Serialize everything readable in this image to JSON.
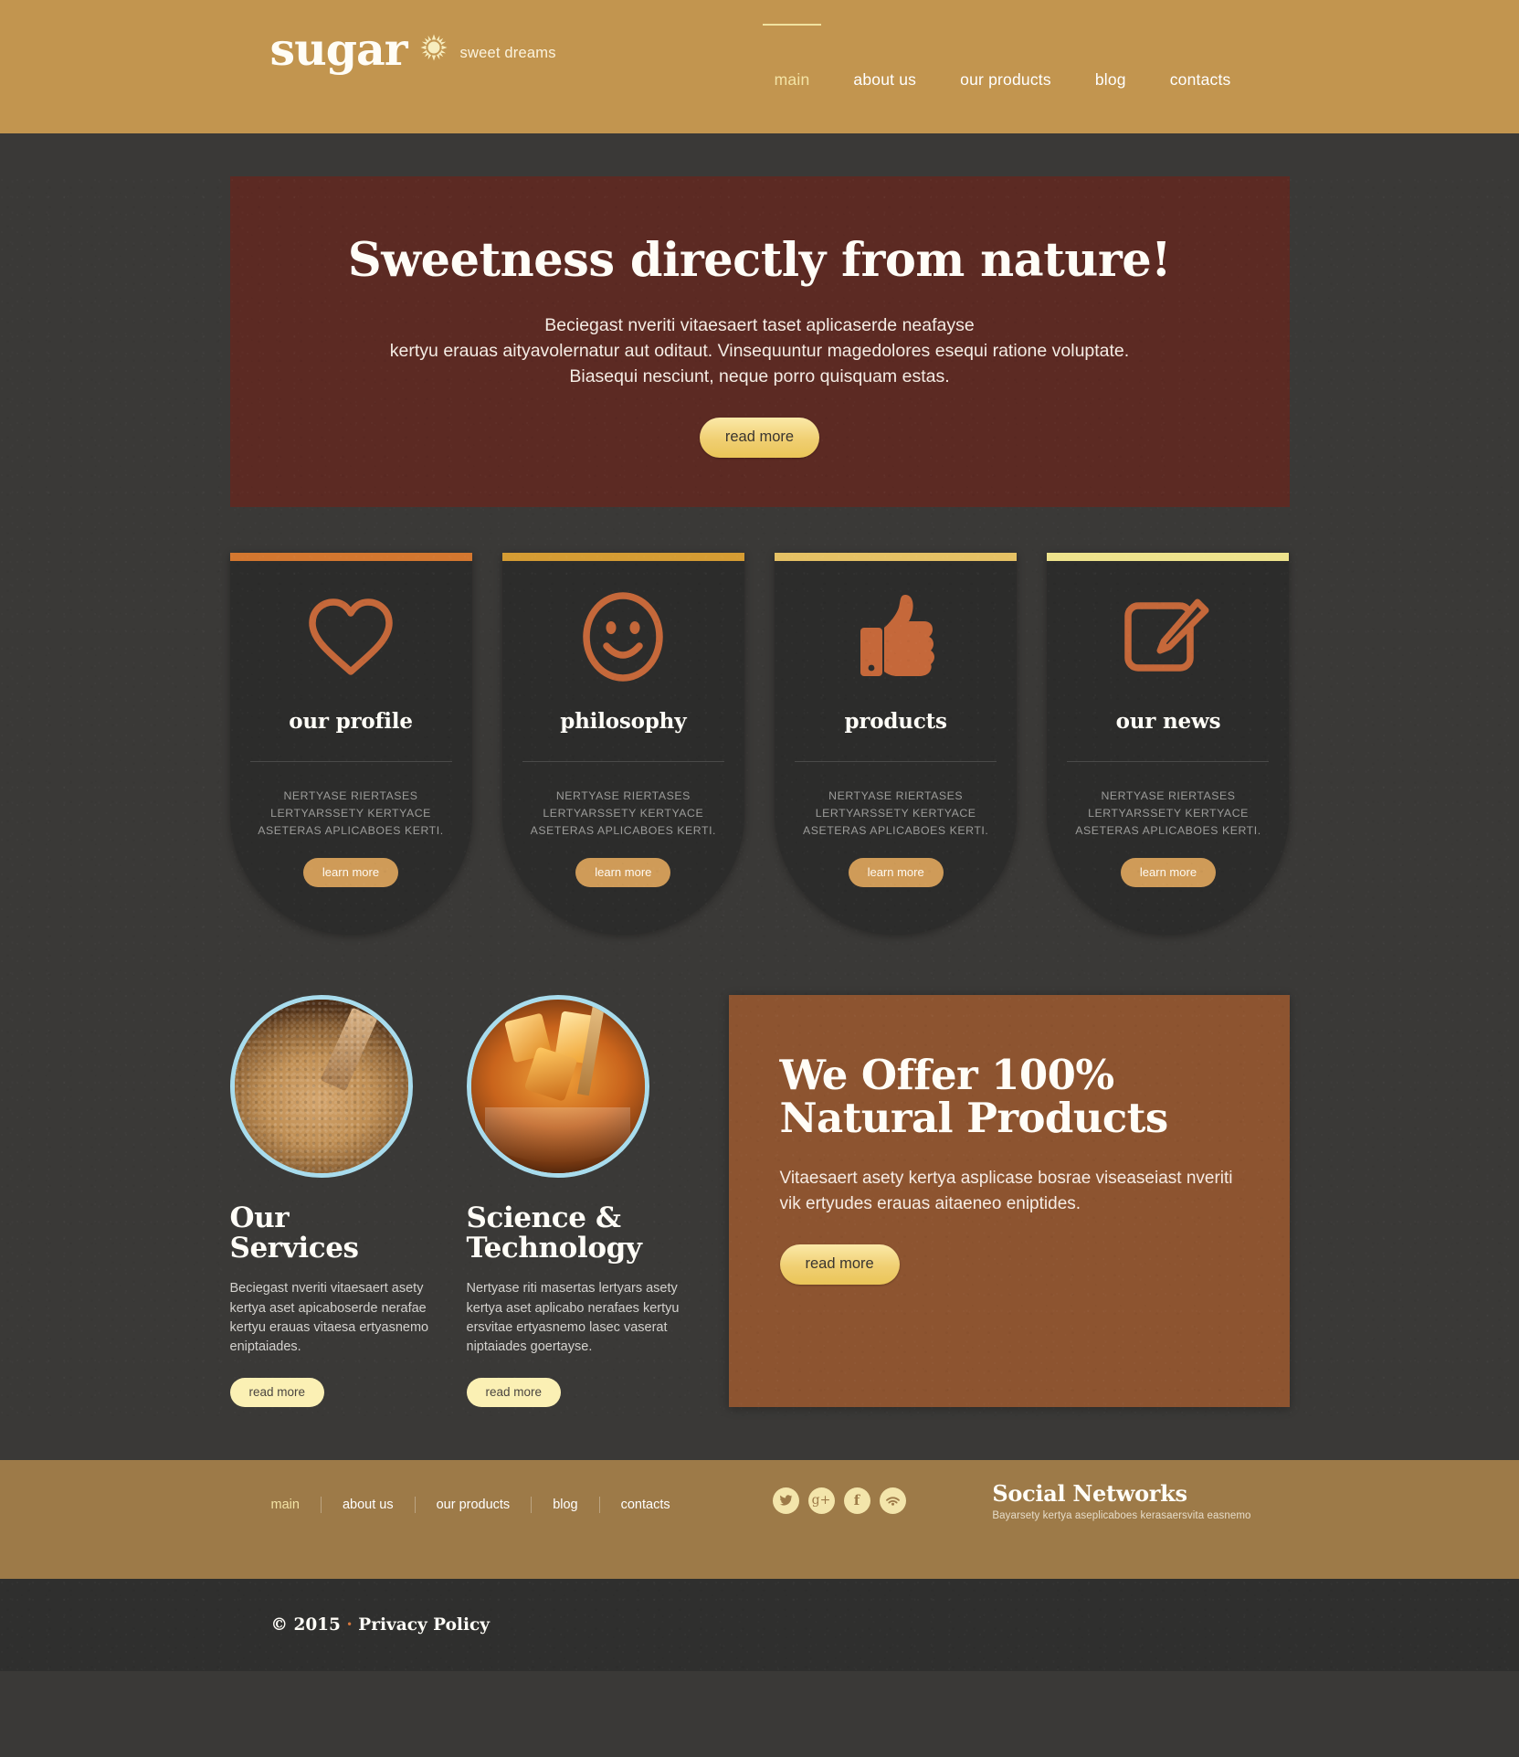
{
  "header": {
    "logo": "sugar",
    "logo_icon": "sun-icon",
    "tagline": "sweet dreams",
    "nav": [
      {
        "label": "main",
        "active": true
      },
      {
        "label": "about us",
        "active": false
      },
      {
        "label": "our products",
        "active": false
      },
      {
        "label": "blog",
        "active": false
      },
      {
        "label": "contacts",
        "active": false
      }
    ],
    "bg_color": "#c2954f",
    "accent_color": "#f0e2a0"
  },
  "hero": {
    "title": "Sweetness directly from nature!",
    "line1": "Beciegast nveriti vitaesaert taset aplicaserde neafayse",
    "line2": "kertyu erauas aityavolernatur aut oditaut. Vinsequuntur magedolores esequi ratione voluptate.",
    "line3": "Biasequi nesciunt, neque porro quisquam estas.",
    "button": "read more",
    "bg_color": "#5c2a23"
  },
  "cards": [
    {
      "icon": "heart-icon",
      "title": "our profile",
      "text": "NERTYASE RIERTASES LERTYARSSETY KERTYACE ASETERAS APLICABOES KERTI.",
      "button": "learn more",
      "bar_color": "#d4772f"
    },
    {
      "icon": "smiley-icon",
      "title": "philosophy",
      "text": "NERTYASE RIERTASES LERTYARSSETY KERTYACE ASETERAS APLICABOES KERTI.",
      "button": "learn more",
      "bar_color": "#d59c33"
    },
    {
      "icon": "thumbs-up-icon",
      "title": "products",
      "text": "NERTYASE RIERTASES LERTYARSSETY KERTYACE ASETERAS APLICABOES KERTI.",
      "button": "learn more",
      "bar_color": "#e5c164"
    },
    {
      "icon": "edit-icon",
      "title": "our news",
      "text": "NERTYASE RIERTASES LERTYARSSETY KERTYACE ASETERAS APLICABOES KERTI.",
      "button": "learn more",
      "bar_color": "#eee38c"
    }
  ],
  "services": [
    {
      "image": "brown-sugar-bowl-photo",
      "title": "Our\nServices",
      "text": "Beciegast nveriti vitaesaert asety kertya aset apicaboserde nerafae kertyu erauas vitaesa ertyasnemo eniptaiades.",
      "button": "read more"
    },
    {
      "image": "rock-candy-honey-photo",
      "title": "Science &\nTechnology",
      "text": "Nertyase riti masertas lertyars asety kertya aset aplicabo nerafaes kertyu ersvitae ertyasnemo lasec vaserat niptaiades goertayse.",
      "button": "read more"
    }
  ],
  "offer": {
    "title": "We Offer 100% Natural Products",
    "text": "Vitaesaert asety kertya asplicase bosrae viseaseiast nveriti vik ertyudes erauas aitaeneo eniptides.",
    "button": "read more",
    "bg_color": "#8d5430"
  },
  "footer": {
    "nav": [
      {
        "label": "main",
        "active": true
      },
      {
        "label": "about us",
        "active": false
      },
      {
        "label": "our products",
        "active": false
      },
      {
        "label": "blog",
        "active": false
      },
      {
        "label": "contacts",
        "active": false
      }
    ],
    "socials": [
      {
        "name": "twitter-icon",
        "glyph": ""
      },
      {
        "name": "google-plus-icon",
        "glyph": "g+"
      },
      {
        "name": "facebook-icon",
        "glyph": "f"
      },
      {
        "name": "rss-icon",
        "glyph": ""
      }
    ],
    "social_title": "Social Networks",
    "social_subtitle": "Bayarsety kertya aseplicaboes kerasaersvita easnemo",
    "bg_color": "#9d7a48"
  },
  "copyright": {
    "symbol_year": "© 2015",
    "dot": "·",
    "privacy": "Privacy Policy"
  }
}
